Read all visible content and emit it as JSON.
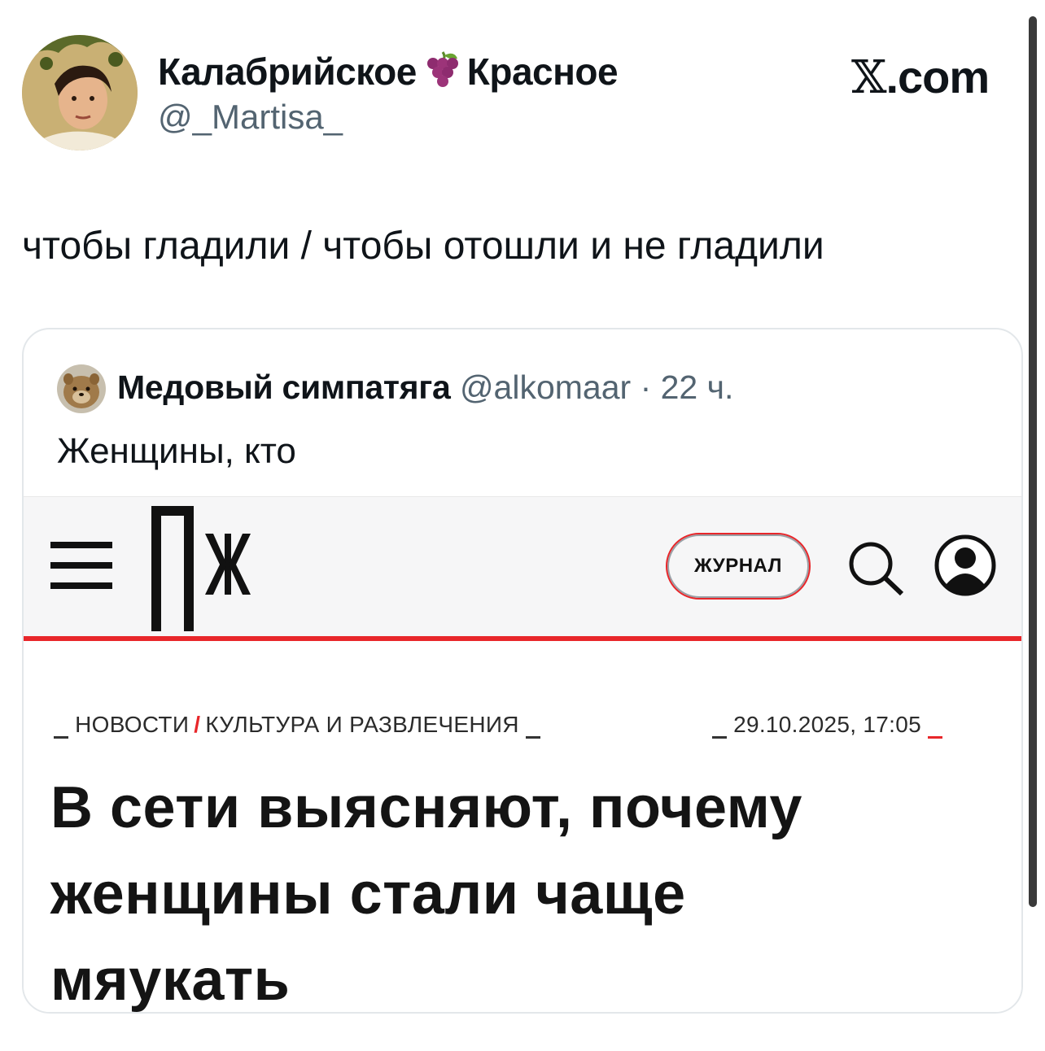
{
  "tweet": {
    "author": {
      "name_part1": "Калабрийское",
      "name_emoji": "grape-emoji",
      "name_part2": "Красное",
      "handle": "@_Martisa_"
    },
    "brand": {
      "x": "𝕏",
      "rest": ".com"
    },
    "text": "чтобы гладили / чтобы отошли и не гладили"
  },
  "quote": {
    "name": "Медовый симпатяга",
    "meta": "@alkomaar · 22 ч.",
    "text": "Женщины, кто",
    "site": {
      "nav_pill": "ЖУРНАЛ",
      "breadcrumb": {
        "section": "НОВОСТИ",
        "subsection": "КУЛЬТУРА И РАЗВЛЕЧЕНИЯ"
      },
      "date": "29.10.2025, 17:05",
      "headline_lines": [
        "В сети выясняют, почему",
        "женщины стали чаще",
        "мяукать"
      ],
      "accent_color": "#e8262a",
      "icons": [
        "hamburger-icon",
        "logo-pzh",
        "search-icon",
        "user-icon"
      ]
    }
  }
}
